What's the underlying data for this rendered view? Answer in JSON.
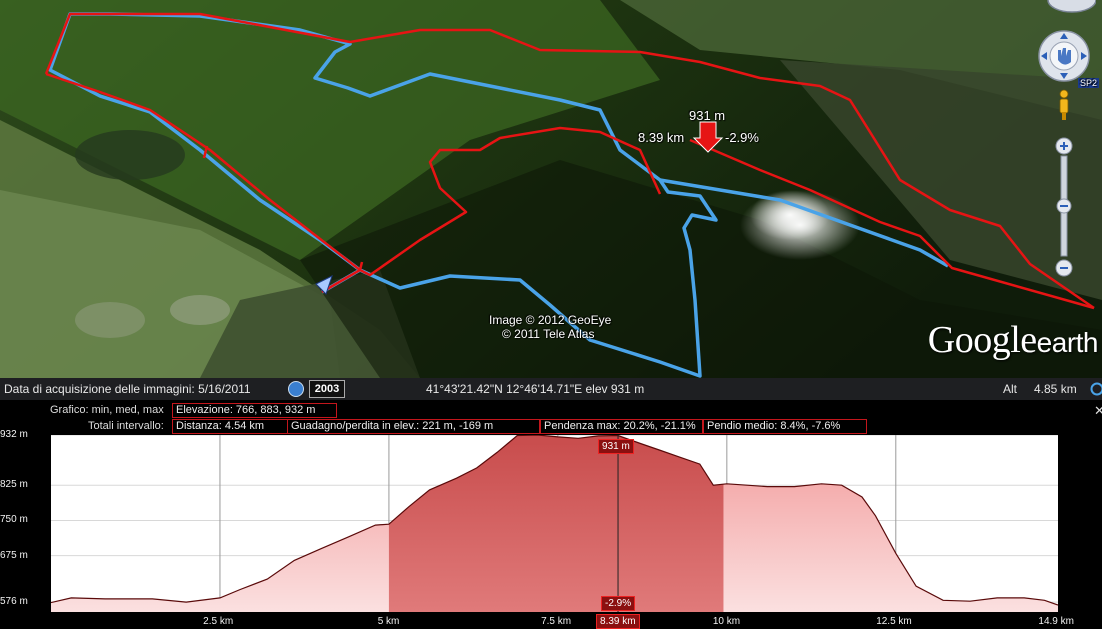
{
  "map": {
    "imagery_credit": "Image © 2012 GeoEye",
    "data_credit": "© 2011 Tele Atlas",
    "logo_main": "Google",
    "logo_sub": "earth",
    "marker_elevation": "931 m",
    "marker_distance": "8.39 km",
    "marker_slope": "-2.9%",
    "road_label": "SP2"
  },
  "status": {
    "acquisition_label": "Data di acquisizione delle immagini: 5/16/2011",
    "year": "2003",
    "coordinates": "41°43'21.42\"N  12°46'14.71\"E  elev   931 m",
    "alt_label": "Alt",
    "alt_value": "4.85 km"
  },
  "profile": {
    "graph_label": "Grafico: min, med, max",
    "elevation": "Elevazione: 766, 883, 932 m",
    "totals_label": "Totali intervallo:",
    "distance": "Distanza: 4.54 km",
    "gain_loss": "Guadagno/perdita in elev.: 221 m, -169 m",
    "max_slope": "Pendenza max: 20.2%, -21.1%",
    "avg_slope": "Pendio medio: 8.4%, -7.6%",
    "cursor_elev": "931 m",
    "cursor_slope": "-2.9%",
    "cursor_dist": "8.39 km",
    "close": "✕"
  },
  "chart_data": {
    "type": "area",
    "x_unit": "km",
    "y_unit": "m",
    "y_ticks": [
      "576 m",
      "675 m",
      "750 m",
      "825 m",
      "932 m"
    ],
    "y_tick_values": [
      576,
      675,
      750,
      825,
      932
    ],
    "x_ticks": [
      "2.5 km",
      "5 km",
      "7.5 km",
      "10 km",
      "12.5 km",
      "14.9 km"
    ],
    "x_tick_values": [
      2.5,
      5,
      7.5,
      10,
      12.5,
      14.9
    ],
    "xlim": [
      0,
      14.9
    ],
    "ylim": [
      555,
      932
    ],
    "selection_km": [
      5.0,
      9.95
    ],
    "cursor_km": 8.39,
    "grid": true,
    "x": [
      0,
      0.3,
      0.8,
      1.5,
      2.0,
      2.5,
      2.8,
      3.2,
      3.6,
      4.0,
      4.4,
      4.8,
      5.0,
      5.3,
      5.6,
      6.0,
      6.3,
      6.6,
      6.9,
      7.2,
      7.5,
      7.8,
      8.1,
      8.39,
      8.7,
      9.0,
      9.3,
      9.6,
      9.8,
      10.0,
      10.3,
      10.6,
      11.0,
      11.4,
      11.7,
      12.0,
      12.2,
      12.5,
      12.8,
      13.2,
      13.6,
      14.0,
      14.4,
      14.7,
      14.9
    ],
    "y": [
      575,
      585,
      583,
      583,
      576,
      585,
      603,
      625,
      665,
      690,
      715,
      740,
      742,
      780,
      815,
      840,
      862,
      895,
      931,
      932,
      928,
      925,
      930,
      931,
      915,
      900,
      885,
      870,
      825,
      828,
      825,
      822,
      822,
      828,
      825,
      800,
      760,
      680,
      610,
      580,
      578,
      585,
      585,
      580,
      570
    ]
  }
}
